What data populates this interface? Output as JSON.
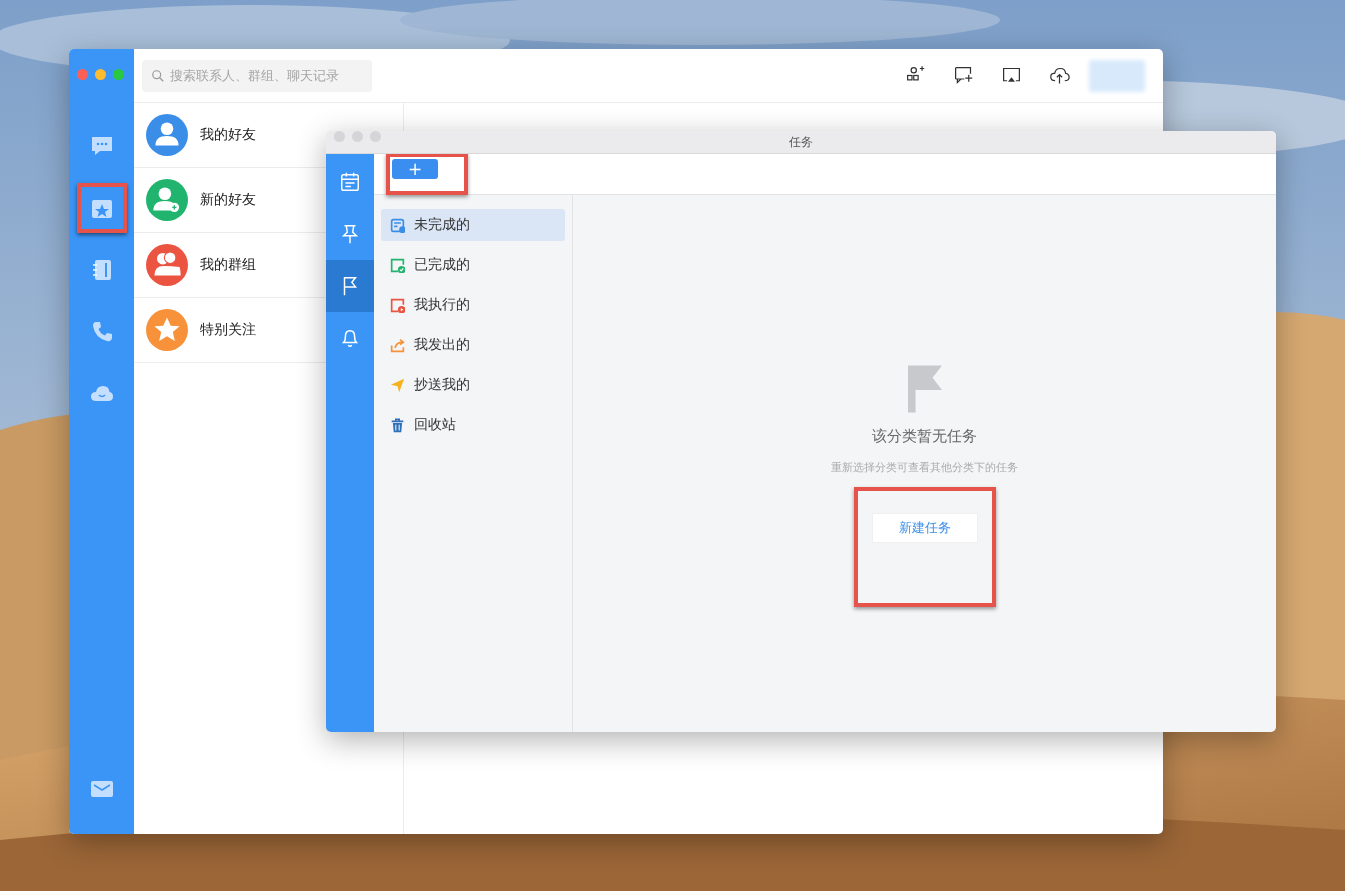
{
  "main_window": {
    "search": {
      "placeholder": "搜索联系人、群组、聊天记录"
    },
    "toolbar": [
      {
        "kind": "group-add"
      },
      {
        "kind": "chat-add"
      },
      {
        "kind": "screen"
      },
      {
        "kind": "cloud-upload"
      }
    ],
    "sidebar": {
      "items": [
        {
          "kind": "chat",
          "highlighted": false
        },
        {
          "kind": "task",
          "highlighted": true
        },
        {
          "kind": "contacts",
          "highlighted": false
        },
        {
          "kind": "phone",
          "highlighted": false
        },
        {
          "kind": "cloud",
          "highlighted": false
        }
      ],
      "bottom_items": [
        {
          "kind": "mail"
        }
      ]
    },
    "contacts": [
      {
        "label": "我的好友",
        "kind": "person",
        "color": "#3a8ee8"
      },
      {
        "label": "新的好友",
        "kind": "person-add",
        "color": "#21b46e"
      },
      {
        "label": "我的群组",
        "kind": "group",
        "color": "#ea5441"
      },
      {
        "label": "特别关注",
        "kind": "star",
        "color": "#f7923a"
      }
    ]
  },
  "task_window": {
    "title": "任务",
    "add_button": {
      "label": "+",
      "highlighted": true
    },
    "nav": [
      {
        "kind": "calendar",
        "selected": false
      },
      {
        "kind": "pin",
        "selected": false
      },
      {
        "kind": "flag",
        "selected": true
      },
      {
        "kind": "bell",
        "selected": false
      }
    ],
    "categories": [
      {
        "label": "未完成的",
        "kind": "pending",
        "color": "#3a8ee8",
        "selected": true
      },
      {
        "label": "已完成的",
        "kind": "done",
        "color": "#21b46e",
        "selected": false
      },
      {
        "label": "我执行的",
        "kind": "doing",
        "color": "#ea5441",
        "selected": false
      },
      {
        "label": "我发出的",
        "kind": "sent",
        "color": "#f7923a",
        "selected": false
      },
      {
        "label": "抄送我的",
        "kind": "cc",
        "color": "#f5b31e",
        "selected": false
      },
      {
        "label": "回收站",
        "kind": "trash",
        "color": "#2d6fb8",
        "selected": false
      }
    ],
    "empty_state": {
      "title": "该分类暂无任务",
      "hint": "重新选择分类可查看其他分类下的任务",
      "button": {
        "label": "新建任务",
        "highlighted": true
      }
    }
  }
}
